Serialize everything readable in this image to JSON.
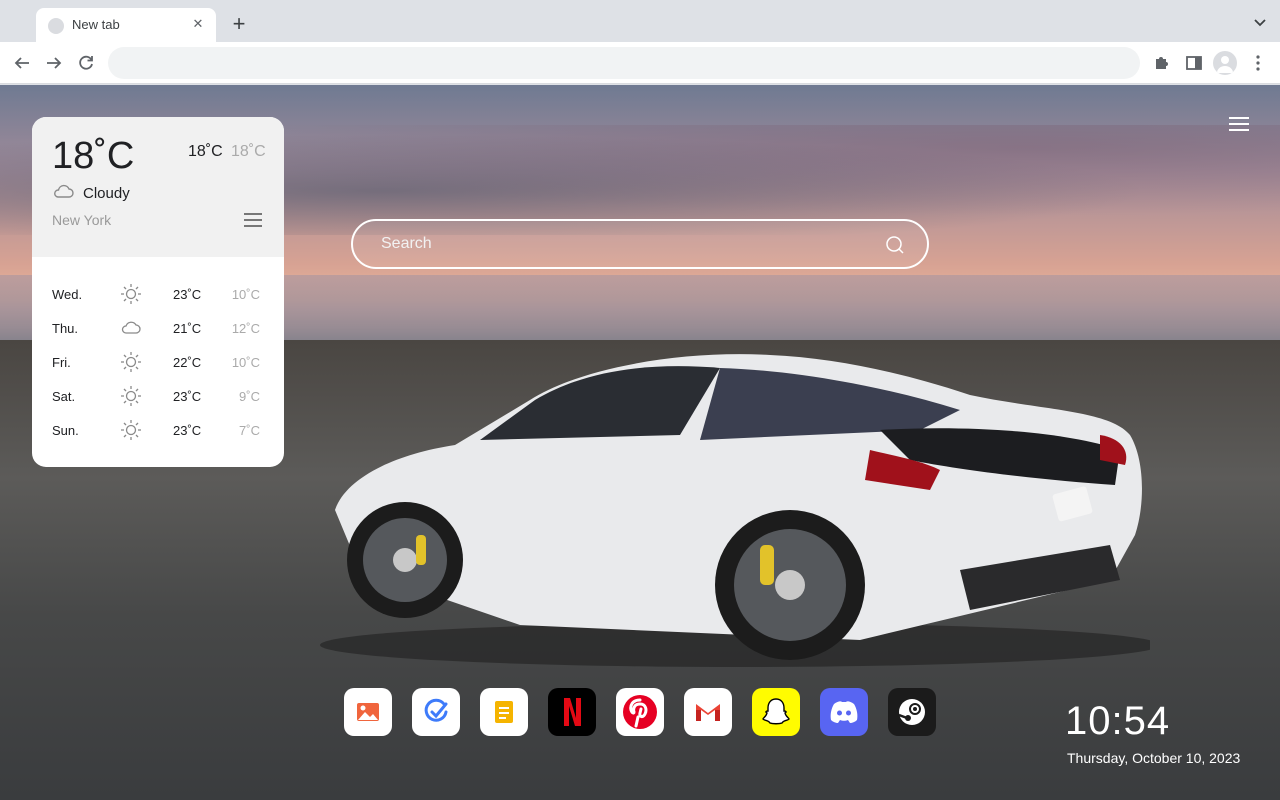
{
  "browser": {
    "tab_title": "New tab",
    "tab_close": "✕",
    "new_tab": "+",
    "omnibox_value": ""
  },
  "weather": {
    "current_temp": "18˚C",
    "high": "18˚C",
    "low": "18˚C",
    "condition": "Cloudy",
    "condition_icon": "cloud-icon",
    "city": "New York",
    "forecast": [
      {
        "day": "Wed.",
        "icon": "sun-icon",
        "high": "23˚C",
        "low": "10˚C"
      },
      {
        "day": "Thu.",
        "icon": "cloud-icon",
        "high": "21˚C",
        "low": "12˚C"
      },
      {
        "day": "Fri.",
        "icon": "sun-icon",
        "high": "22˚C",
        "low": "10˚C"
      },
      {
        "day": "Sat.",
        "icon": "sun-icon",
        "high": "23˚C",
        "low": "9˚C"
      },
      {
        "day": "Sun.",
        "icon": "sun-icon",
        "high": "23˚C",
        "low": "7˚C"
      }
    ]
  },
  "search": {
    "placeholder": "Search"
  },
  "dock": {
    "apps": [
      "gallery",
      "todo",
      "notes",
      "netflix",
      "pinterest",
      "gmail",
      "snapchat",
      "discord",
      "steam"
    ]
  },
  "clock": {
    "time": "10:54",
    "date": "Thursday, October 10, 2023"
  },
  "colors": {
    "netflix": "#e50914",
    "pinterest": "#e60023",
    "snapchat": "#fffc00",
    "discord": "#5865f2",
    "steam": "#1b1b1b"
  }
}
